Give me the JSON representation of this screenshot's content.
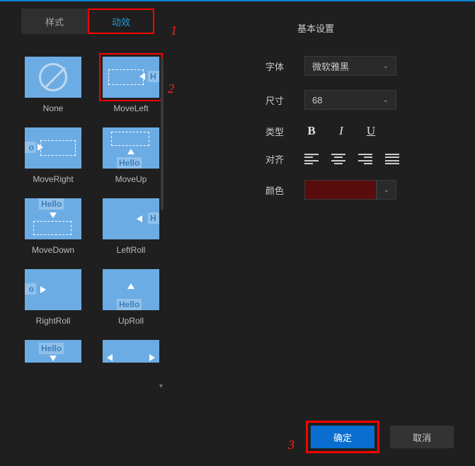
{
  "tabs": {
    "style": "样式",
    "effect": "动效"
  },
  "callouts": {
    "c1": "1",
    "c2": "2",
    "c3": "3"
  },
  "effects": {
    "none": "None",
    "moveleft": "MoveLeft",
    "moveright": "MoveRight",
    "moveup": "MoveUp",
    "movedown": "MoveDown",
    "leftroll": "LeftRoll",
    "rightroll": "RightRoll",
    "uproll": "UpRoll",
    "hello_text": "Hello"
  },
  "settings": {
    "section_title": "基本设置",
    "font_label": "字体",
    "font_value": "微软雅黑",
    "size_label": "尺寸",
    "size_value": "68",
    "type_label": "类型",
    "bold": "B",
    "italic": "I",
    "underline": "U",
    "align_label": "对齐",
    "color_label": "颜色",
    "color_value": "#5a0d0d"
  },
  "buttons": {
    "ok": "确定",
    "cancel": "取消"
  }
}
